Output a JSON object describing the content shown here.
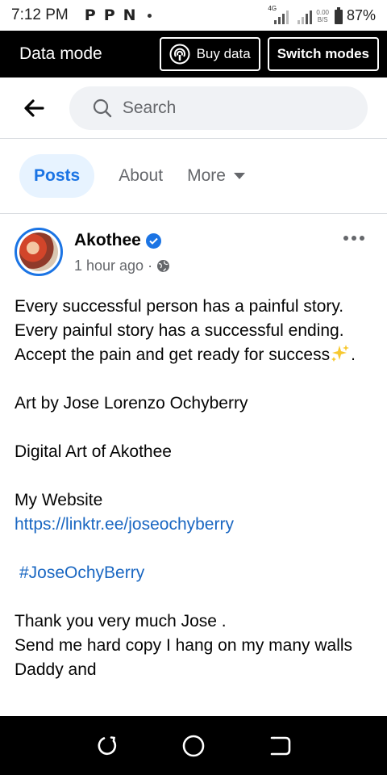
{
  "status_bar": {
    "time": "7:12 PM",
    "notification_icons": [
      "P",
      "P",
      "N"
    ],
    "network_label": "4G",
    "net_speed_value": "0.00",
    "net_speed_unit": "B/S",
    "battery": "87%"
  },
  "data_mode_bar": {
    "title": "Data mode",
    "buy_data_label": "Buy data",
    "switch_modes_label": "Switch modes"
  },
  "header": {
    "search_placeholder": "Search"
  },
  "tabs": [
    {
      "label": "Posts",
      "active": true
    },
    {
      "label": "About",
      "active": false
    },
    {
      "label": "More",
      "active": false
    }
  ],
  "post": {
    "author": "Akothee",
    "time": "1 hour ago",
    "paragraph_1": "Every successful person has a painful story. Every painful story has a successful ending. Accept the pain and get ready for success",
    "paragraph_1_end": ".",
    "art_credit": "Art by Jose Lorenzo Ochyberry",
    "digital_art": "Digital Art of Akothee",
    "website_label": "My Website",
    "website_url": "https://linktr.ee/joseochyberry",
    "hashtag": "#JoseOchyBerry",
    "thanks_line_1": "Thank you very much Jose .",
    "thanks_line_2": "Send me hard copy I hang on my many walls",
    "cut_off_line": "Daddy and"
  },
  "colors": {
    "accent": "#1b74e4",
    "link": "#1a67c2",
    "muted": "#65676b",
    "bar_bg": "#000000"
  }
}
